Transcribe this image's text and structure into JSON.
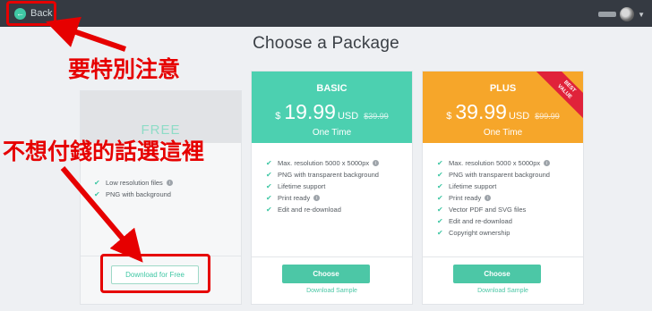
{
  "topbar": {
    "back_label": "Back"
  },
  "page": {
    "title": "Choose a Package"
  },
  "cards": [
    {
      "name": "FREE",
      "features": [
        "Low resolution files",
        "PNG with background"
      ],
      "cta": "Download for Free"
    },
    {
      "name": "BASIC",
      "currency": "$",
      "price": "19.99",
      "unit": "USD",
      "old_price": "$39.99",
      "term": "One Time",
      "features": [
        "Max. resolution 5000 x 5000px",
        "PNG with transparent background",
        "Lifetime support",
        "Print ready",
        "Edit and re-download"
      ],
      "cta": "Choose",
      "sample": "Download Sample"
    },
    {
      "name": "PLUS",
      "currency": "$",
      "price": "39.99",
      "unit": "USD",
      "old_price": "$99.99",
      "term": "One Time",
      "ribbon_line1": "BEST",
      "ribbon_line2": "VALUE",
      "features": [
        "Max. resolution 5000 x 5000px",
        "PNG with transparent background",
        "Lifetime support",
        "Print ready",
        "Vector PDF and SVG files",
        "Edit and re-download",
        "Copyright ownership"
      ],
      "cta": "Choose",
      "sample": "Download Sample"
    }
  ],
  "annotations": {
    "top": "要特別注意",
    "free": "不想付錢的話選這裡"
  },
  "colors": {
    "accent": "#4cc7a6",
    "basic": "#4cd0b0",
    "plus": "#f6a62a",
    "ribbon": "#e0223a",
    "annotation": "#e60000"
  },
  "icons": {
    "back": "arrow-left-icon",
    "check": "check-icon",
    "info": "info-icon"
  }
}
